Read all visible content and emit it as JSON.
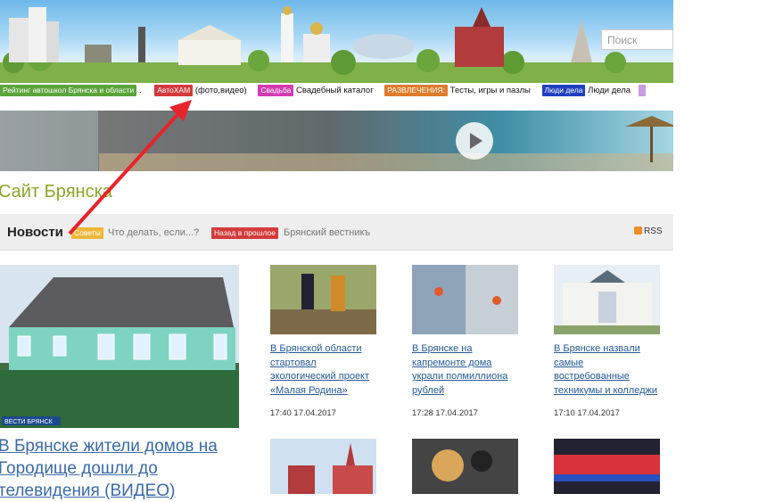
{
  "header": {
    "search_placeholder": "Поиск"
  },
  "tags": [
    {
      "label": "Рейтинг автошкол Брянска и области",
      "text": ".",
      "color": "#5aa43a"
    },
    {
      "label": "АвтоХАМ",
      "text": "(фото,видео)",
      "color": "#d43b3b"
    },
    {
      "label": "Свадьба",
      "text": "Свадебный каталог",
      "color": "#d23bb2"
    },
    {
      "label": "РАЗВЛЕЧЕНИЯ:",
      "text": "Тесты, игры и пазлы",
      "color": "#e07b2a"
    },
    {
      "label": "Люди дела",
      "text": "Люди дела",
      "color": "#1f3fc0"
    }
  ],
  "site_title": "Сайт Брянска",
  "news_bar": {
    "title": "Новости",
    "tag1": "Советы",
    "text1": "Что делать, если...?",
    "tag2": "Назад в прошлое",
    "text2": "Брянский вестникъ",
    "rss": "RSS"
  },
  "main_news": {
    "headline": "В Брянске жители домов на Городище дошли до телевидения (ВИДЕО)",
    "logo_text": "ВЕСТИ БРЯНСК"
  },
  "news_cards": [
    {
      "title": "В Брянской области стартовал экологический проект «Малая Родина»",
      "time": "17:40 17.04.2017"
    },
    {
      "title": "В Брянске на капремонте дома украли полмиллиона рублей",
      "time": "17:28 17.04.2017"
    },
    {
      "title": "В Брянске назвали самые востребованные техникумы и колледжи",
      "time": "17:10 17.04.2017"
    }
  ]
}
